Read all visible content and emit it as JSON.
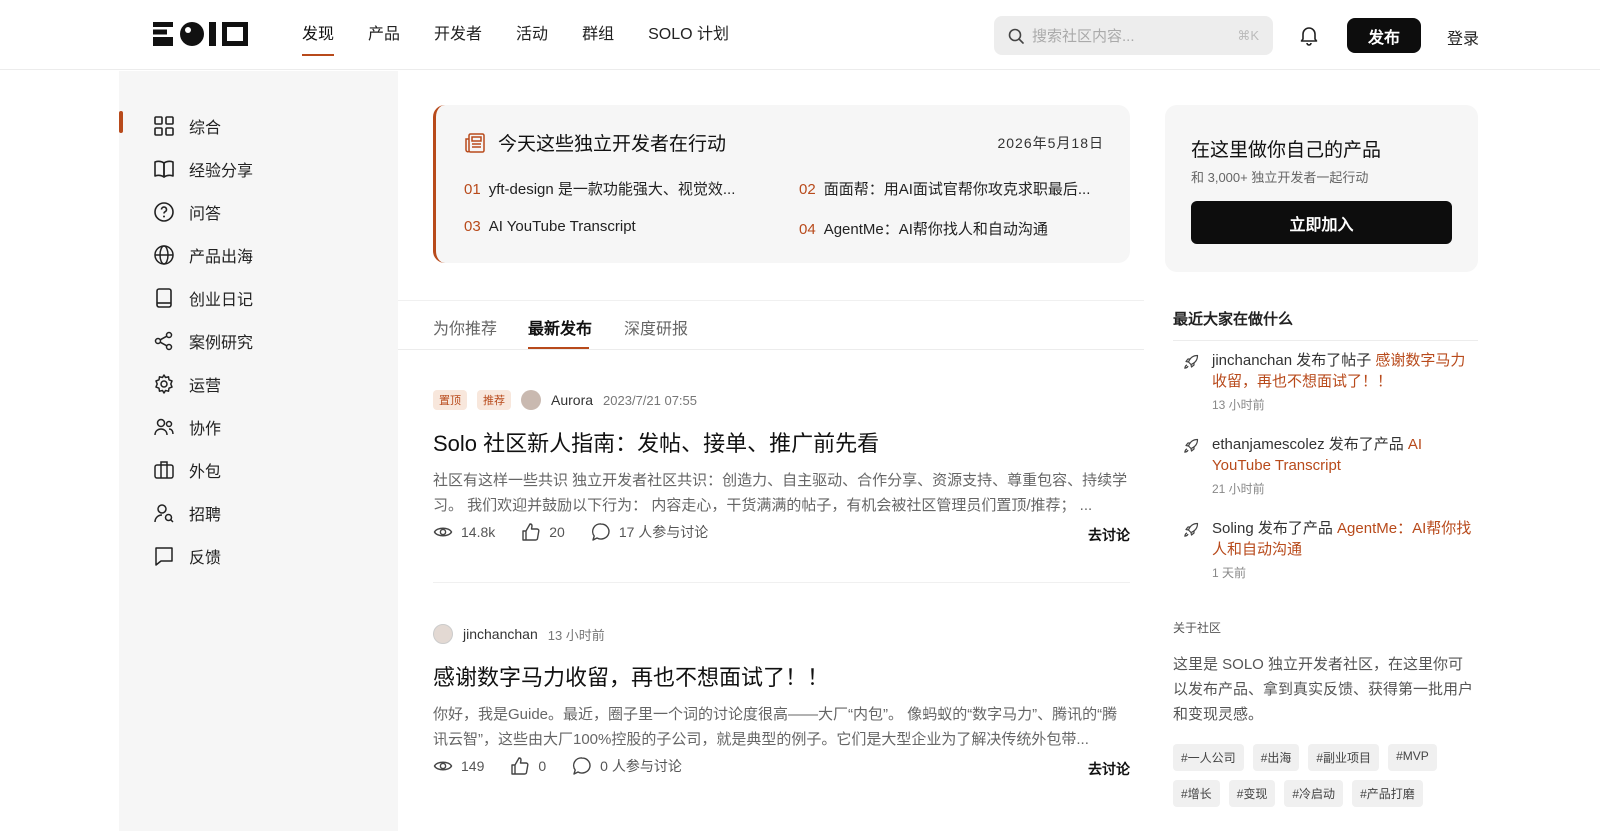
{
  "header": {
    "logo_text": "SOLO",
    "nav": [
      {
        "label": "发现",
        "active": true
      },
      {
        "label": "产品",
        "active": false
      },
      {
        "label": "开发者",
        "active": false
      },
      {
        "label": "活动",
        "active": false
      },
      {
        "label": "群组",
        "active": false
      },
      {
        "label": "SOLO 计划",
        "active": false
      }
    ],
    "search_placeholder": "搜索社区内容...",
    "search_shortcut": "⌘K",
    "publish_label": "发布",
    "login_label": "登录"
  },
  "sidebar": {
    "items": [
      {
        "label": "综合",
        "icon": "grid-icon",
        "active": true
      },
      {
        "label": "经验分享",
        "icon": "book-open-icon"
      },
      {
        "label": "问答",
        "icon": "question-icon"
      },
      {
        "label": "产品出海",
        "icon": "globe-icon"
      },
      {
        "label": "创业日记",
        "icon": "notebook-icon"
      },
      {
        "label": "案例研究",
        "icon": "share-icon"
      },
      {
        "label": "运营",
        "icon": "gear-icon"
      },
      {
        "label": "协作",
        "icon": "users-icon"
      },
      {
        "label": "外包",
        "icon": "briefcase-icon"
      },
      {
        "label": "招聘",
        "icon": "user-search-icon"
      },
      {
        "label": "反馈",
        "icon": "message-icon"
      }
    ]
  },
  "today": {
    "title": "今天这些独立开发者在行动",
    "date": "2026年5月18日",
    "links": [
      {
        "num": "01",
        "text": "yft-design 是一款功能强大、视觉效..."
      },
      {
        "num": "02",
        "text": "面面帮：用AI面试官帮你攻克求职最后..."
      },
      {
        "num": "03",
        "text": "AI YouTube Transcript"
      },
      {
        "num": "04",
        "text": "AgentMe：AI帮你找人和自动沟通"
      }
    ]
  },
  "tabs": [
    {
      "label": "为你推荐",
      "active": false
    },
    {
      "label": "最新发布",
      "active": true
    },
    {
      "label": "深度研报",
      "active": false
    }
  ],
  "posts": [
    {
      "badges": [
        "置顶",
        "推荐"
      ],
      "author": "Aurora",
      "time": "2023/7/21 07:55",
      "title": "Solo 社区新人指南：发帖、接单、推广前先看",
      "excerpt": "社区有这样一些共识 独立开发者社区共识：创造力、自主驱动、合作分享、资源支持、尊重包容、持续学习。 我们欢迎并鼓励以下行为： 内容走心，干货满满的帖子，有机会被社区管理员们置顶/推荐； ...",
      "views": "14.8k",
      "likes": "20",
      "comments": "17 人参与讨论",
      "discuss_label": "去讨论"
    },
    {
      "badges": [],
      "author": "jinchanchan",
      "time": "13 小时前",
      "title": "感谢数字马力收留，再也不想面试了！！",
      "excerpt": "你好，我是Guide。最近，圈子里一个词的讨论度很高——大厂“内包”。 像蚂蚁的“数字马力”、腾讯的“腾讯云智”，这些由大厂100%控股的子公司，就是典型的例子。它们是大型企业为了解决传统外包带...",
      "views": "149",
      "likes": "0",
      "comments": "0 人参与讨论",
      "discuss_label": "去讨论"
    }
  ],
  "join_card": {
    "title": "在这里做你自己的产品",
    "subtitle": "和 3,000+ 独立开发者一起行动",
    "button": "立即加入"
  },
  "recent": {
    "title": "最近大家在做什么",
    "items": [
      {
        "prefix": "jinchanchan 发布了帖子 ",
        "highlight": "感谢数字马力收留，再也不想面试了！！",
        "ago": "13 小时前"
      },
      {
        "prefix": "ethanjamescolez 发布了产品 ",
        "highlight": "AI YouTube Transcript",
        "ago": "21 小时前"
      },
      {
        "prefix": "Soling 发布了产品 ",
        "highlight": "AgentMe：AI帮你找人和自动沟通",
        "ago": "1 天前"
      }
    ]
  },
  "about": {
    "label": "关于社区",
    "text": "这里是 SOLO 独立开发者社区，在这里你可以发布产品、拿到真实反馈、获得第一批用户和变现灵感。",
    "tags": [
      "#一人公司",
      "#出海",
      "#副业项目",
      "#MVP",
      "#增长",
      "#变现",
      "#冷启动",
      "#产品打磨"
    ]
  },
  "colors": {
    "accent": "#b84a1b",
    "dark": "#0d0d0d",
    "panel": "#f6f6f6"
  }
}
